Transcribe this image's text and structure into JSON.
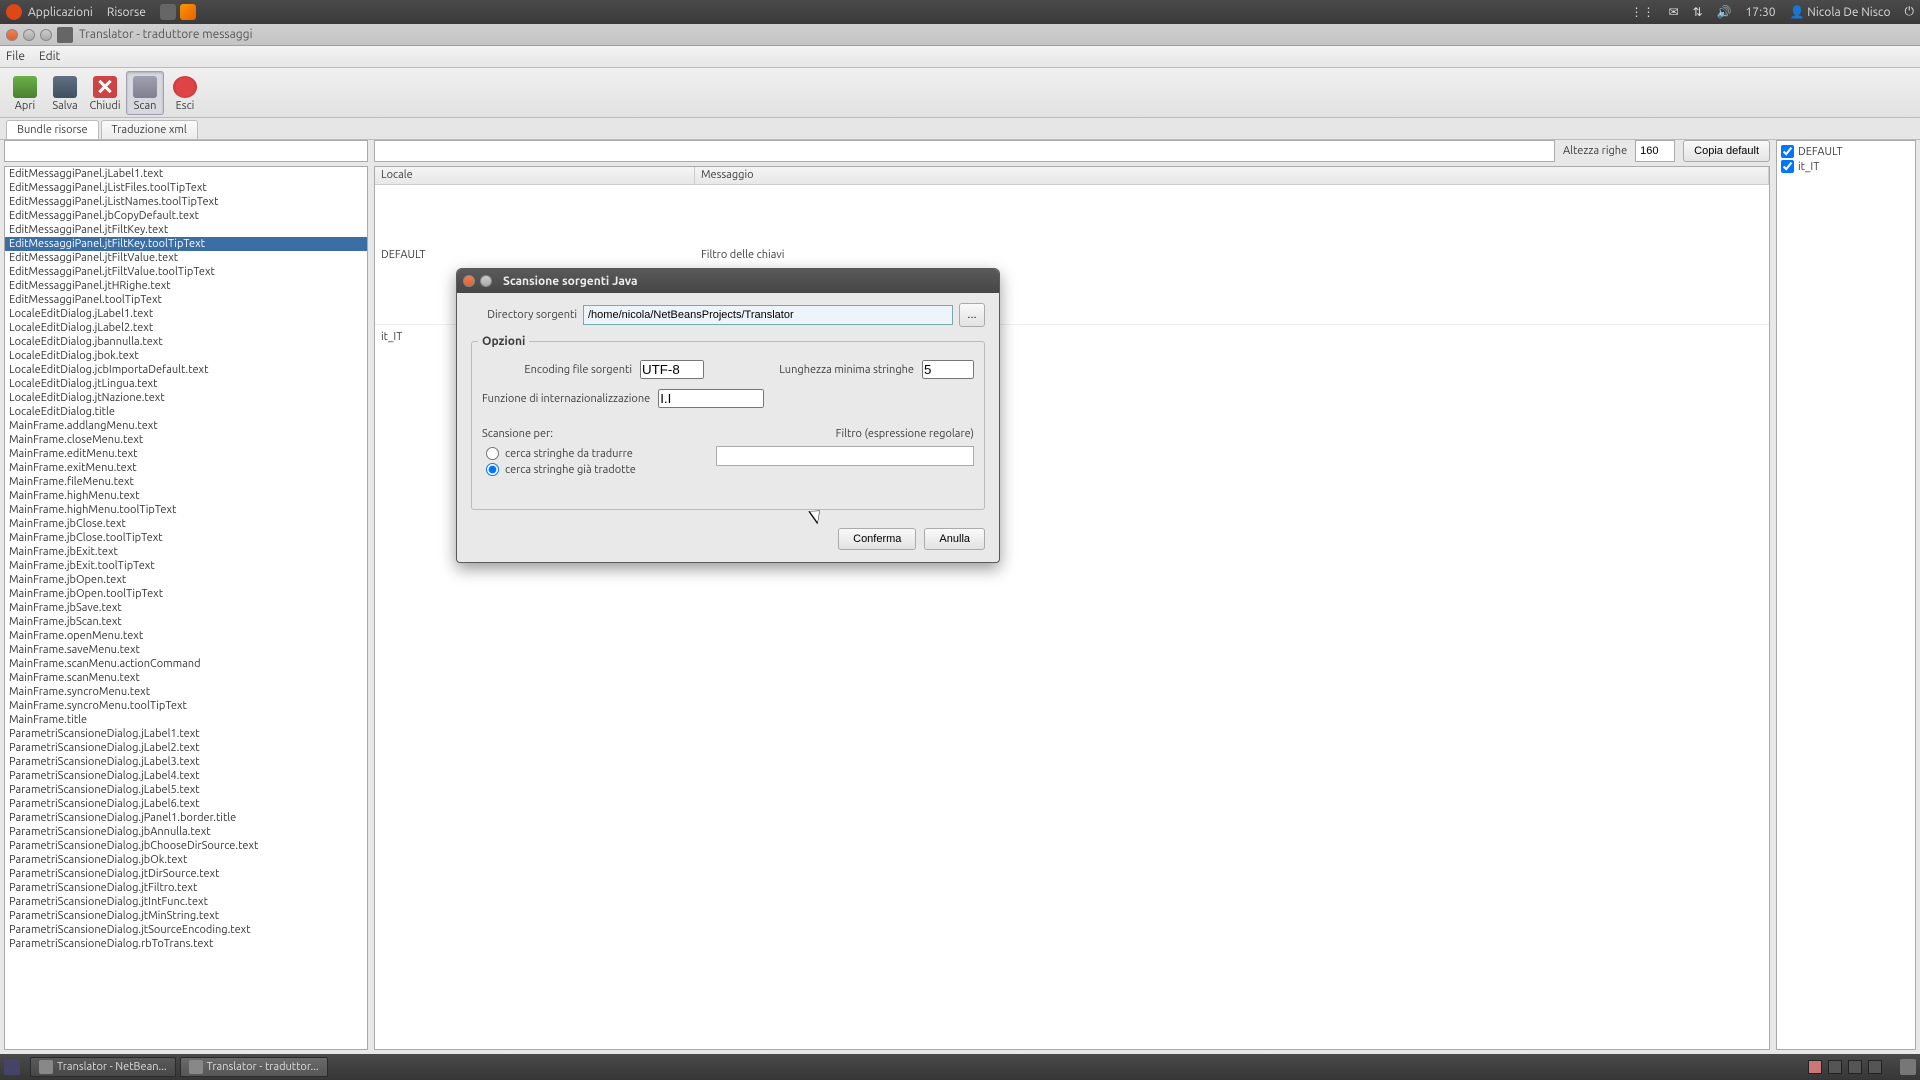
{
  "os_panel": {
    "menu_apps": "Applicazioni",
    "menu_resources": "Risorse",
    "clock": "17:30",
    "user": "Nicola De Nisco"
  },
  "app": {
    "title": "Translator - traduttore messaggi",
    "menu": {
      "file": "File",
      "edit": "Edit"
    },
    "toolbar": {
      "open": "Apri",
      "save": "Salva",
      "close": "Chiudi",
      "scan": "Scan",
      "exit": "Esci"
    },
    "tabs": [
      {
        "label": "Bundle risorse",
        "active": true
      },
      {
        "label": "Traduzione xml",
        "active": false
      }
    ]
  },
  "mid": {
    "row_height_label": "Altezza righe",
    "row_height_value": "160",
    "copy_default": "Copia default",
    "col_locale": "Locale",
    "col_message": "Messaggio",
    "rows": [
      {
        "locale": "DEFAULT",
        "message": "Filtro delle chiavi"
      },
      {
        "locale": "it_IT",
        "message": ""
      }
    ]
  },
  "locales": [
    {
      "name": "DEFAULT",
      "checked": true
    },
    {
      "name": "it_IT",
      "checked": true
    }
  ],
  "keys": [
    "EditMessaggiPanel.jLabel1.text",
    "EditMessaggiPanel.jListFiles.toolTipText",
    "EditMessaggiPanel.jListNames.toolTipText",
    "EditMessaggiPanel.jbCopyDefault.text",
    "EditMessaggiPanel.jtFiltKey.text",
    "EditMessaggiPanel.jtFiltKey.toolTipText",
    "EditMessaggiPanel.jtFiltValue.text",
    "EditMessaggiPanel.jtFiltValue.toolTipText",
    "EditMessaggiPanel.jtHRighe.text",
    "EditMessaggiPanel.toolTipText",
    "LocaleEditDialog.jLabel1.text",
    "LocaleEditDialog.jLabel2.text",
    "LocaleEditDialog.jbannulla.text",
    "LocaleEditDialog.jbok.text",
    "LocaleEditDialog.jcbImportaDefault.text",
    "LocaleEditDialog.jtLingua.text",
    "LocaleEditDialog.jtNazione.text",
    "LocaleEditDialog.title",
    "MainFrame.addlangMenu.text",
    "MainFrame.closeMenu.text",
    "MainFrame.editMenu.text",
    "MainFrame.exitMenu.text",
    "MainFrame.fileMenu.text",
    "MainFrame.highMenu.text",
    "MainFrame.highMenu.toolTipText",
    "MainFrame.jbClose.text",
    "MainFrame.jbClose.toolTipText",
    "MainFrame.jbExit.text",
    "MainFrame.jbExit.toolTipText",
    "MainFrame.jbOpen.text",
    "MainFrame.jbOpen.toolTipText",
    "MainFrame.jbSave.text",
    "MainFrame.jbScan.text",
    "MainFrame.openMenu.text",
    "MainFrame.saveMenu.text",
    "MainFrame.scanMenu.actionCommand",
    "MainFrame.scanMenu.text",
    "MainFrame.syncroMenu.text",
    "MainFrame.syncroMenu.toolTipText",
    "MainFrame.title",
    "ParametriScansioneDialog.jLabel1.text",
    "ParametriScansioneDialog.jLabel2.text",
    "ParametriScansioneDialog.jLabel3.text",
    "ParametriScansioneDialog.jLabel4.text",
    "ParametriScansioneDialog.jLabel5.text",
    "ParametriScansioneDialog.jLabel6.text",
    "ParametriScansioneDialog.jPanel1.border.title",
    "ParametriScansioneDialog.jbAnnulla.text",
    "ParametriScansioneDialog.jbChooseDirSource.text",
    "ParametriScansioneDialog.jbOk.text",
    "ParametriScansioneDialog.jtDirSource.text",
    "ParametriScansioneDialog.jtFiltro.text",
    "ParametriScansioneDialog.jtIntFunc.text",
    "ParametriScansioneDialog.jtMinString.text",
    "ParametriScansioneDialog.jtSourceEncoding.text",
    "ParametriScansioneDialog.rbToTrans.text"
  ],
  "selected_key_index": 5,
  "dialog": {
    "title": "Scansione sorgenti Java",
    "dir_label": "Directory sorgenti",
    "dir_value": "/home/nicola/NetBeansProjects/Translator",
    "browse": "...",
    "options_legend": "Opzioni",
    "encoding_label": "Encoding file sorgenti",
    "encoding_value": "UTF-8",
    "minlen_label": "Lunghezza minima stringhe",
    "minlen_value": "5",
    "intfunc_label": "Funzione di internazionalizzazione",
    "intfunc_value": "I.I",
    "scanfor_label": "Scansione per:",
    "filter_label": "Filtro (espressione regolare)",
    "radio_to_translate": "cerca stringhe da tradurre",
    "radio_translated": "cerca stringhe già tradotte",
    "filter_value": "",
    "confirm": "Conferma",
    "cancel": "Anulla"
  },
  "taskbar": {
    "btn1": "Translator - NetBean...",
    "btn2": "Translator - traduttor..."
  }
}
